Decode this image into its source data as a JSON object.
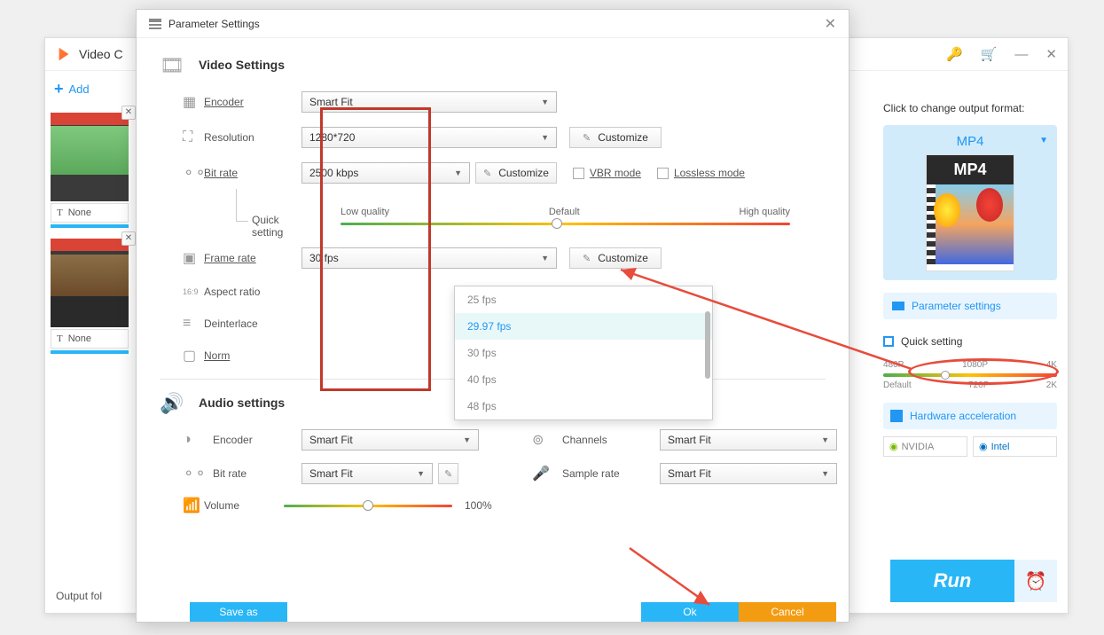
{
  "back": {
    "title": "Video C",
    "add": "Add",
    "none": "None",
    "output": "Output fol",
    "key_icon": "🔑",
    "cart_icon": "🛒"
  },
  "right": {
    "change_format": "Click to change output format:",
    "format": "MP4",
    "mp4_label": "MP4",
    "param_settings": "Parameter settings",
    "quick_setting": "Quick setting",
    "res1": "480P",
    "res2": "1080P",
    "res3": "4K",
    "res4": "Default",
    "res5": "720P",
    "res6": "2K",
    "hardware": "Hardware acceleration",
    "nvidia": "NVIDIA",
    "intel": "Intel",
    "run": "Run"
  },
  "modal": {
    "title": "Parameter Settings",
    "video_section": "Video Settings",
    "encoder": "Encoder",
    "encoder_val": "Smart Fit",
    "resolution": "Resolution",
    "resolution_val": "1280*720",
    "bitrate": "Bit rate",
    "bitrate_val": "2500 kbps",
    "vbr": "VBR mode",
    "lossless": "Lossless mode",
    "customize": "Customize",
    "low_q": "Low quality",
    "default_q": "Default",
    "high_q": "High quality",
    "quick_setting": "Quick setting",
    "framerate": "Frame rate",
    "framerate_val": "30 fps",
    "aspect": "Aspect ratio",
    "deinterlace": "Deinterlace",
    "norm": "Norm",
    "audio_section": "Audio settings",
    "a_encoder": "Encoder",
    "a_bitrate": "Bit rate",
    "channels": "Channels",
    "samplerate": "Sample rate",
    "smartfit": "Smart Fit",
    "volume": "Volume",
    "vol_pct": "100%",
    "save_as": "Save as",
    "ok": "Ok",
    "cancel": "Cancel"
  },
  "fps_menu": [
    "25 fps",
    "29.97 fps",
    "30 fps",
    "40 fps",
    "48 fps"
  ]
}
